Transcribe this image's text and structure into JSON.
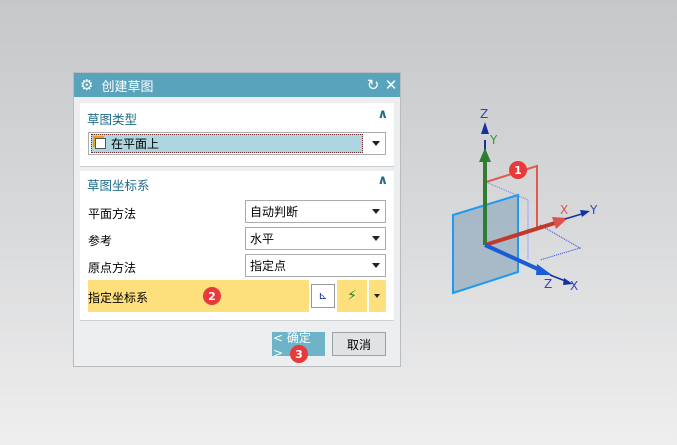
{
  "dialog": {
    "title": "创建草图",
    "reset_icon": "reset-icon",
    "close_icon": "close-icon"
  },
  "sketch_type": {
    "header": "草图类型",
    "value": "在平面上"
  },
  "sketch_csys": {
    "header": "草图坐标系",
    "rows": [
      {
        "label": "平面方法",
        "value": "自动判断"
      },
      {
        "label": "参考",
        "value": "水平"
      },
      {
        "label": "原点方法",
        "value": "指定点"
      }
    ],
    "specify_csys": "指定坐标系"
  },
  "buttons": {
    "ok": "< 确定 >",
    "cancel": "取消"
  },
  "badges": [
    "1",
    "2",
    "3"
  ],
  "triad": {
    "z": "Z",
    "y": "Y",
    "x": "X",
    "z2": "Z",
    "x2": "X",
    "y2": "Y"
  },
  "colors": {
    "title": "#5aa3bd",
    "highlight": "#fde07c",
    "badge": "#e8393b"
  }
}
